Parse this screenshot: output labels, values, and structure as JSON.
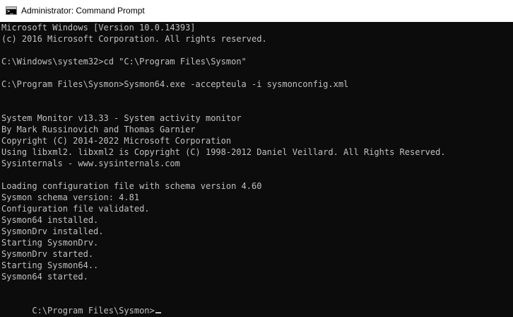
{
  "window": {
    "title": "Administrator: Command Prompt",
    "icon": "cmd-icon"
  },
  "console": {
    "lines": [
      "Microsoft Windows [Version 10.0.14393]",
      "(c) 2016 Microsoft Corporation. All rights reserved.",
      "",
      "C:\\Windows\\system32>cd \"C:\\Program Files\\Sysmon\"",
      "",
      "C:\\Program Files\\Sysmon>Sysmon64.exe -accepteula -i sysmonconfig.xml",
      "",
      "",
      "System Monitor v13.33 - System activity monitor",
      "By Mark Russinovich and Thomas Garnier",
      "Copyright (C) 2014-2022 Microsoft Corporation",
      "Using libxml2. libxml2 is Copyright (C) 1998-2012 Daniel Veillard. All Rights Reserved.",
      "Sysinternals - www.sysinternals.com",
      "",
      "Loading configuration file with schema version 4.60",
      "Sysmon schema version: 4.81",
      "Configuration file validated.",
      "Sysmon64 installed.",
      "SysmonDrv installed.",
      "Starting SysmonDrv.",
      "SysmonDrv started.",
      "Starting Sysmon64..",
      "Sysmon64 started.",
      ""
    ],
    "prompt": "C:\\Program Files\\Sysmon>"
  }
}
